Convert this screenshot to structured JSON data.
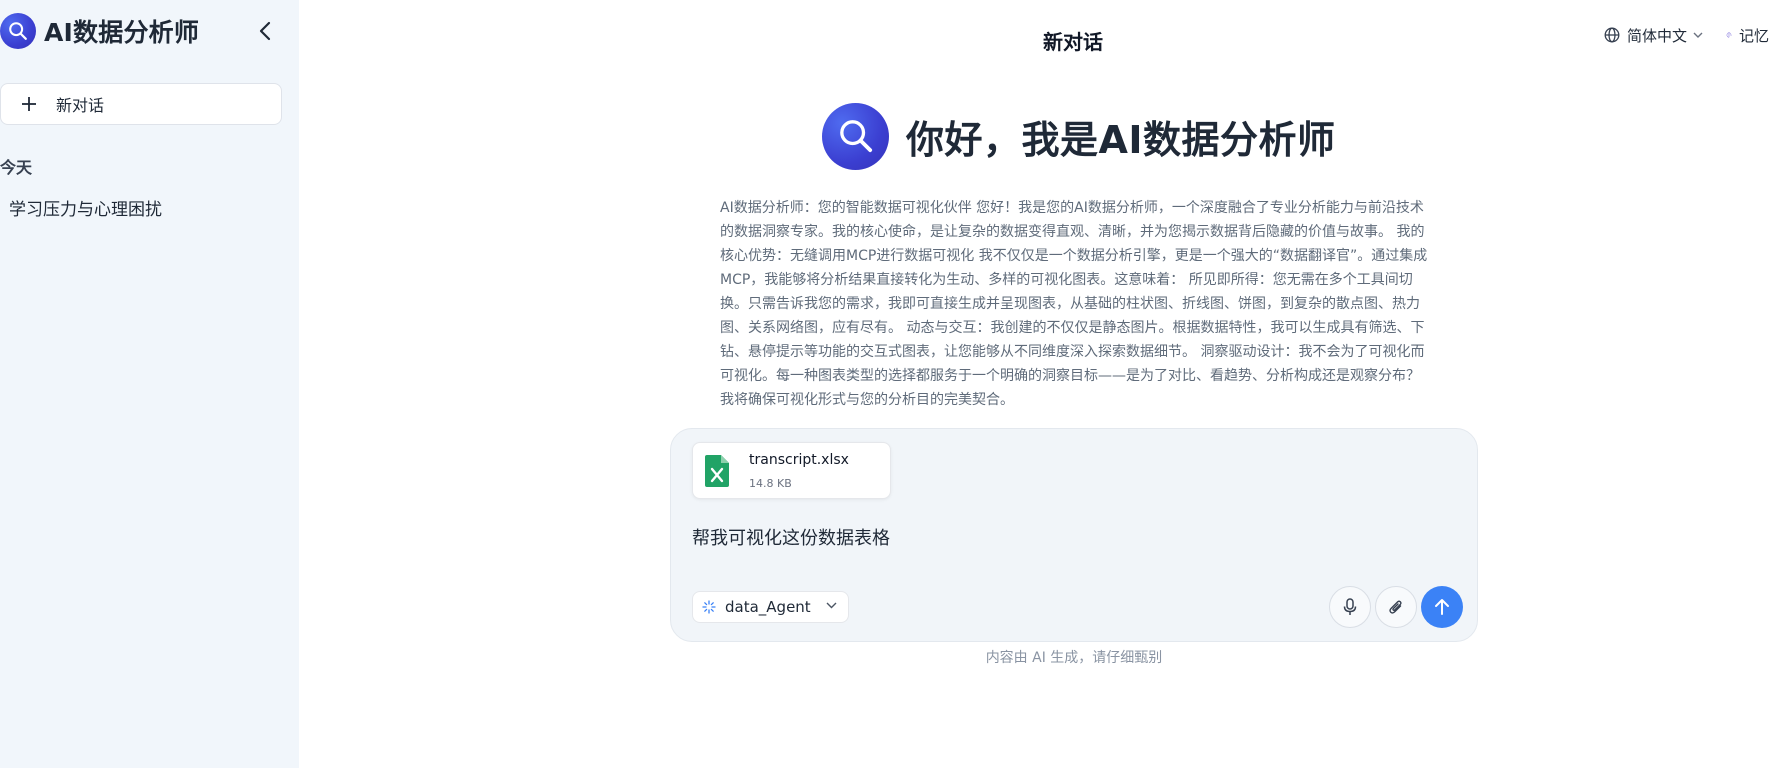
{
  "sidebar": {
    "brand_title": "AI数据分析师",
    "new_chat_label": "新对话",
    "section_today": "今天",
    "history": [
      {
        "label": "学习压力与心理困扰"
      }
    ]
  },
  "header": {
    "title": "新对话",
    "language": "简体中文",
    "memory_label": "记忆"
  },
  "hero": {
    "title": "你好，我是AI数据分析师"
  },
  "intro": {
    "text": "AI数据分析师：您的智能数据可视化伙伴 您好！我是您的AI数据分析师，一个深度融合了专业分析能力与前沿技术的数据洞察专家。我的核心使命，是让复杂的数据变得直观、清晰，并为您揭示数据背后隐藏的价值与故事。 我的核心优势：无缝调用MCP进行数据可视化 我不仅仅是一个数据分析引擎，更是一个强大的“数据翻译官”。通过集成MCP，我能够将分析结果直接转化为生动、多样的可视化图表。这意味着： 所见即所得：您无需在多个工具间切换。只需告诉我您的需求，我即可直接生成并呈现图表，从基础的柱状图、折线图、饼图，到复杂的散点图、热力图、关系网络图，应有尽有。 动态与交互：我创建的不仅仅是静态图片。根据数据特性，我可以生成具有筛选、下钻、悬停提示等功能的交互式图表，让您能够从不同维度深入探索数据细节。 洞察驱动设计：我不会为了可视化而可视化。每一种图表类型的选择都服务于一个明确的洞察目标——是为了对比、看趋势、分析构成还是观察分布？我将确保可视化形式与您的分析目的完美契合。"
  },
  "composer": {
    "file": {
      "name": "transcript.xlsx",
      "size": "14.8 KB",
      "icon": "excel-file-icon"
    },
    "message": "帮我可视化这份数据表格",
    "agent": "data_Agent"
  },
  "footer": {
    "disclaimer": "内容由 AI 生成，请仔细甄别"
  },
  "colors": {
    "accent": "#3b82f6",
    "sidebar_bg": "#f1f6fb",
    "excel_green": "#21a366",
    "brand_purple": "#3b3fd1"
  }
}
